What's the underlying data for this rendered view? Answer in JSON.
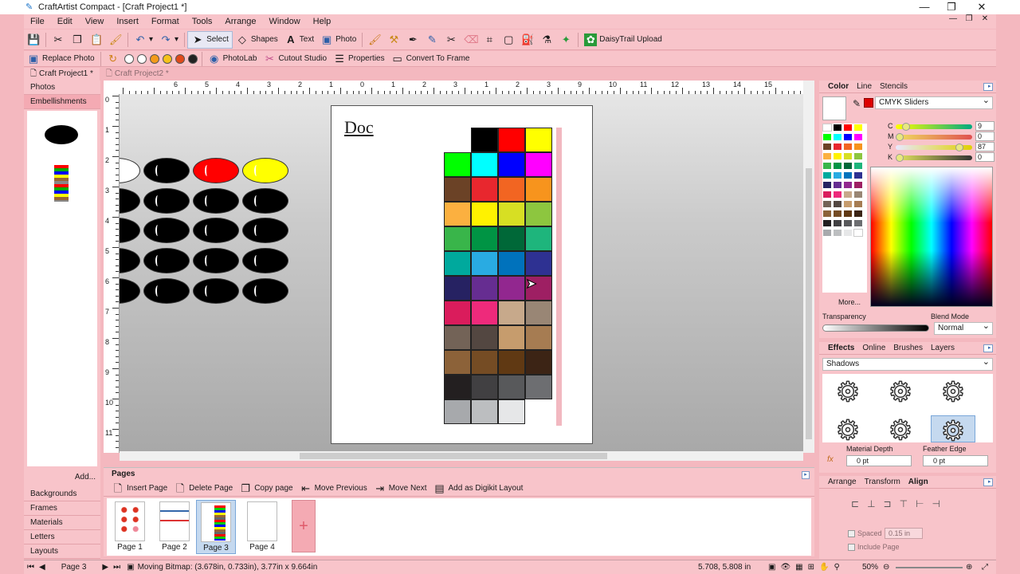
{
  "window": {
    "title": "CraftArtist Compact - [Craft Project1 *]",
    "minimize": "—",
    "maximize": "❐",
    "close": "✕"
  },
  "menu": [
    "File",
    "Edit",
    "View",
    "Insert",
    "Format",
    "Tools",
    "Arrange",
    "Window",
    "Help"
  ],
  "toolbar": {
    "select_label": "Select",
    "shapes_label": "Shapes",
    "text_label": "Text",
    "photo_label": "Photo",
    "daisytrail_label": "DaisyTrail Upload"
  },
  "context_toolbar": {
    "replace_photo": "Replace Photo",
    "photolab": "PhotoLab",
    "cutout_studio": "Cutout Studio",
    "properties": "Properties",
    "convert_to_frame": "Convert To Frame"
  },
  "doc_tabs": [
    "Craft Project1 *",
    "Craft Project2 *"
  ],
  "left_panel": {
    "top_tabs": [
      "Photos",
      "Embellishments"
    ],
    "add_label": "Add...",
    "bottom_tabs": [
      "Backgrounds",
      "Frames",
      "Materials",
      "Letters",
      "Layouts"
    ]
  },
  "ruler": {
    "h_labels": [
      "6",
      "5",
      "4",
      "3",
      "2",
      "1",
      "0",
      "1",
      "2",
      "3",
      "1",
      "2",
      "3",
      "9",
      "10",
      "11",
      "12",
      "13",
      "14",
      "15"
    ],
    "v_labels": [
      "0",
      "1",
      "2",
      "3",
      "4",
      "5",
      "6",
      "7",
      "8",
      "9",
      "10",
      "11"
    ]
  },
  "canvas": {
    "page_text": "Doc",
    "oval_colors": [
      "#ffffff",
      "#000000",
      "#ff0000",
      "#ffff00"
    ],
    "palette_rows": [
      [
        "#ffffff",
        "#000000",
        "#ff0000",
        "#ffff00"
      ],
      [
        "#00ff00",
        "#00ffff",
        "#0000ff",
        "#ff00ff"
      ],
      [
        "#6b4226",
        "#e8272e",
        "#f26522",
        "#f7941d"
      ],
      [
        "#fbb040",
        "#fff200",
        "#d7df23",
        "#8dc63f"
      ],
      [
        "#39b54a",
        "#009444",
        "#006838",
        "#1eb57c"
      ],
      [
        "#00a99d",
        "#29abe2",
        "#0072bc",
        "#2e3192"
      ],
      [
        "#262262",
        "#662d91",
        "#92278f",
        "#9e1f63"
      ],
      [
        "#da1c5c",
        "#ee2a7b",
        "#c7a98b",
        "#998675"
      ],
      [
        "#736357",
        "#534741",
        "#c69c6d",
        "#a67c52"
      ],
      [
        "#8c6239",
        "#754c24",
        "#603913",
        "#3c2415"
      ],
      [
        "#231f20",
        "#414042",
        "#58595b",
        "#6d6e71"
      ],
      [
        "#a7a9ac",
        "#bcbec0",
        "#e6e7e8",
        "#ffffff"
      ]
    ]
  },
  "pages_panel": {
    "title": "Pages",
    "tools": [
      "Insert Page",
      "Delete Page",
      "Copy page",
      "Move Previous",
      "Move Next",
      "Add as Digikit Layout"
    ],
    "pages": [
      "Page 1",
      "Page 2",
      "Page 3",
      "Page 4"
    ],
    "selected_page": "Page 3"
  },
  "color_panel": {
    "tabs": [
      "Color",
      "Line",
      "Stencils"
    ],
    "mode": "CMYK Sliders",
    "sliders": [
      {
        "label": "C",
        "value": "9",
        "pct": 0.09
      },
      {
        "label": "M",
        "value": "0",
        "pct": 0.0
      },
      {
        "label": "Y",
        "value": "87",
        "pct": 0.87
      },
      {
        "label": "K",
        "value": "0",
        "pct": 0.0
      }
    ],
    "more_label": "More...",
    "transparency_label": "Transparency",
    "blend_mode_label": "Blend Mode",
    "blend_mode_value": "Normal"
  },
  "effects_panel": {
    "tabs": [
      "Effects",
      "Online",
      "Brushes",
      "Layers"
    ],
    "category": "Shadows",
    "material_depth_label": "Material Depth",
    "material_depth_value": "0 pt",
    "feather_edge_label": "Feather Edge",
    "feather_edge_value": "0 pt"
  },
  "align_panel": {
    "tabs": [
      "Arrange",
      "Transform",
      "Align"
    ],
    "spaced_label": "Spaced",
    "spaced_value": "0.15 in",
    "include_page_label": "Include Page"
  },
  "status": {
    "page_label": "Page 3",
    "message": "Moving Bitmap: (3.678in, 0.733in), 3.77in x 9.664in",
    "coords": "5.708,  5.808 in",
    "zoom": "50%"
  }
}
